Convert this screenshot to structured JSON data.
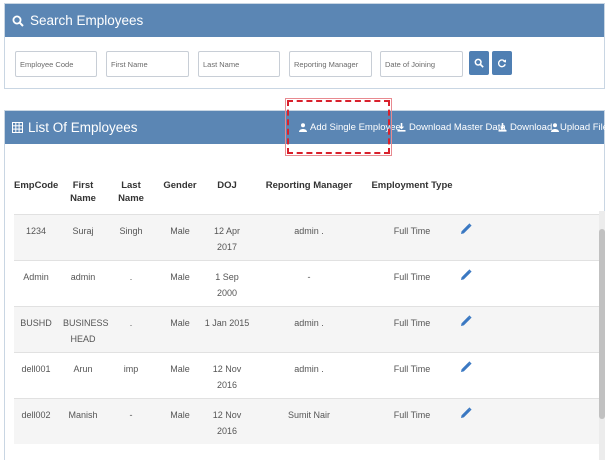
{
  "search_panel": {
    "title": "Search Employees",
    "filters": {
      "employee_code_placeholder": "Employee Code",
      "first_name_placeholder": "First Name",
      "last_name_placeholder": "Last Name",
      "reporting_manager_placeholder": "Reporting Manager",
      "date_of_joining_placeholder": "Date of Joining"
    },
    "buttons": {
      "search_icon": "search-icon",
      "reset_icon": "refresh-icon"
    }
  },
  "list_panel": {
    "title": "List Of Employees",
    "actions": {
      "add_single": "Add Single Employee",
      "download_master": "Download Master Data",
      "download": "Download",
      "upload": "Upload File"
    },
    "columns": {
      "emp_code": "EmpCode",
      "first_name_1": "First",
      "first_name_2": "Name",
      "last_name_1": "Last",
      "last_name_2": "Name",
      "gender": "Gender",
      "doj": "DOJ",
      "reporting_manager": "Reporting Manager",
      "employment_type": "Employment Type"
    },
    "rows": [
      {
        "code": "1234",
        "first_a": "Suraj",
        "first_b": "",
        "last": "Singh",
        "gender": "Male",
        "doj_a": "12 Apr",
        "doj_b": "2017",
        "manager": "admin .",
        "type": "Full Time"
      },
      {
        "code": "Admin",
        "first_a": "admin",
        "first_b": "",
        "last": ".",
        "gender": "Male",
        "doj_a": "1 Sep",
        "doj_b": "2000",
        "manager": "-",
        "type": "Full Time"
      },
      {
        "code": "BUSHD",
        "first_a": "BUSINESS",
        "first_b": "HEAD",
        "last": ".",
        "gender": "Male",
        "doj_a": "1 Jan 2015",
        "doj_b": "",
        "manager": "admin .",
        "type": "Full Time"
      },
      {
        "code": "dell001",
        "first_a": "Arun",
        "first_b": "",
        "last": "imp",
        "gender": "Male",
        "doj_a": "12 Nov",
        "doj_b": "2016",
        "manager": "admin .",
        "type": "Full Time"
      },
      {
        "code": "dell002",
        "first_a": "Manish",
        "first_b": "",
        "last": "-",
        "gender": "Male",
        "doj_a": "12 Nov",
        "doj_b": "2016",
        "manager": "Sumit Nair",
        "type": "Full Time"
      }
    ]
  },
  "colors": {
    "header_blue": "#5b86b4",
    "button_blue": "#4f7fb3",
    "highlight_red": "#d9202c",
    "edit_icon_blue": "#3a78c2"
  }
}
